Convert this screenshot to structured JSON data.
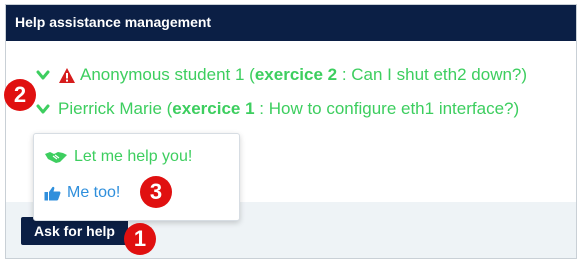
{
  "panel": {
    "title": "Help assistance management"
  },
  "requests": [
    {
      "student": "Anonymous student 1",
      "exercise": "exercice 2",
      "question": "Can I shut eth2 down?",
      "warning": true
    },
    {
      "student": "Pierrick Marie",
      "exercise": "exercice 1",
      "question": "How to configure eth1 interface?",
      "warning": false
    }
  ],
  "popup": {
    "help_label": "Let me help you!",
    "metoo_label": "Me too!",
    "help_icon": "handshake-icon",
    "metoo_icon": "thumbs-up-icon"
  },
  "footer": {
    "ask_label": "Ask for help"
  },
  "annotations": {
    "one": "1",
    "two": "2",
    "three": "3"
  },
  "colors": {
    "header_bg": "#0b1f45",
    "accent_green": "#3dce5f",
    "accent_blue": "#2f8fdc",
    "badge_red": "#e01010",
    "warning_red": "#d61c1c"
  }
}
